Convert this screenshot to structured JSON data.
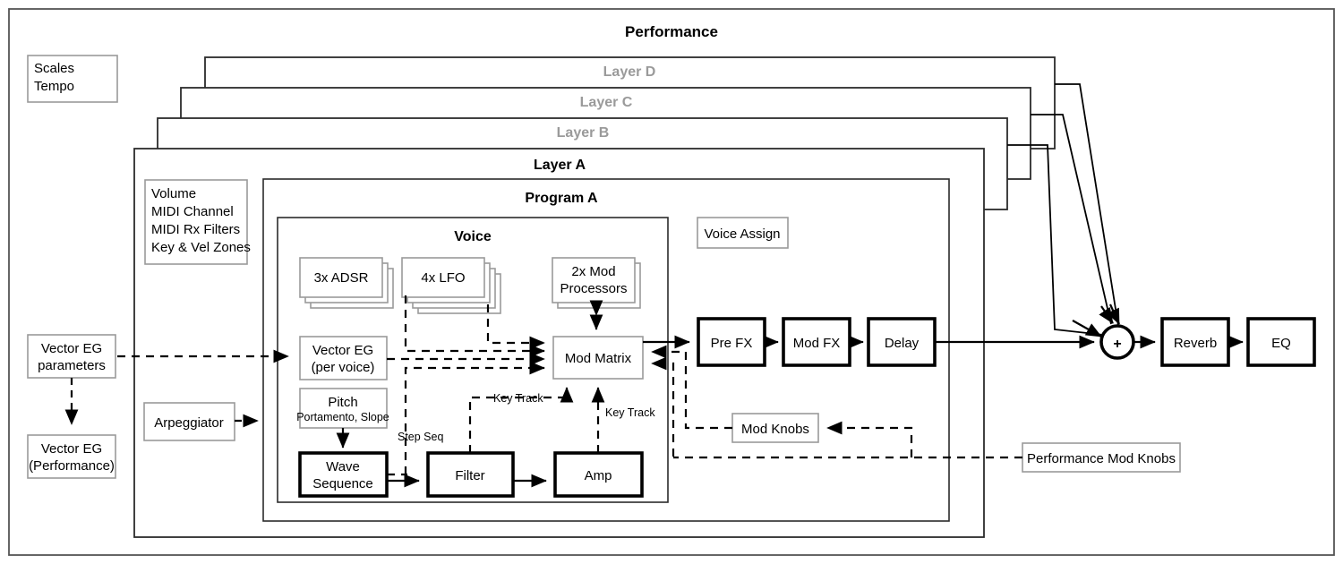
{
  "diagram": {
    "title": "Performance",
    "outer_frame": "performance-frame"
  },
  "global_boxes": {
    "scales_tempo": {
      "line1": "Scales",
      "line2": "Tempo"
    },
    "vector_eg_parameters": {
      "line1": "Vector EG",
      "line2": "parameters"
    },
    "vector_eg_performance": {
      "line1": "Vector EG",
      "line2": "(Performance)"
    },
    "arpeggiator": {
      "label": "Arpeggiator"
    },
    "performance_mod_knobs": {
      "label": "Performance Mod Knobs"
    }
  },
  "layers": [
    {
      "id": "layer-d",
      "label": "Layer D",
      "active": false
    },
    {
      "id": "layer-c",
      "label": "Layer C",
      "active": false
    },
    {
      "id": "layer-b",
      "label": "Layer B",
      "active": false
    },
    {
      "id": "layer-a",
      "label": "Layer A",
      "active": true
    }
  ],
  "layer_a": {
    "title": "Layer A",
    "params_box": {
      "line1": "Volume",
      "line2": "MIDI Channel",
      "line3": "MIDI Rx Filters",
      "line4": "Key & Vel Zones"
    },
    "program": {
      "title": "Program A",
      "voice_assign": "Voice Assign",
      "voice": {
        "title": "Voice",
        "modulators": [
          {
            "id": "adsr",
            "label": "3x ADSR",
            "count": 3
          },
          {
            "id": "lfo",
            "label": "4x LFO",
            "count": 4
          },
          {
            "id": "mod-processors",
            "line1": "2x Mod",
            "line2": "Processors",
            "count": 2
          }
        ],
        "vector_eg": {
          "line1": "Vector EG",
          "line2": "(per voice)"
        },
        "pitch": {
          "line1": "Pitch",
          "line2": "Portamento, Slope"
        },
        "mod_matrix": {
          "label": "Mod Matrix"
        },
        "signal_path": [
          {
            "id": "wave-sequence",
            "line1": "Wave",
            "line2": "Sequence"
          },
          {
            "id": "filter",
            "label": "Filter"
          },
          {
            "id": "amp",
            "label": "Amp"
          }
        ],
        "connection_labels": {
          "step_seq": "Step Seq",
          "key_track_filter": "Key Track",
          "key_track_amp": "Key Track"
        }
      }
    },
    "effects": [
      {
        "id": "pre-fx",
        "label": "Pre FX"
      },
      {
        "id": "mod-fx",
        "label": "Mod FX"
      },
      {
        "id": "delay",
        "label": "Delay"
      }
    ],
    "mod_knobs": {
      "label": "Mod Knobs"
    }
  },
  "master": {
    "mixer": {
      "symbol": "+"
    },
    "effects": [
      {
        "id": "reverb",
        "label": "Reverb"
      },
      {
        "id": "eq",
        "label": "EQ"
      }
    ]
  },
  "colors": {
    "line": "#000000",
    "thin_box_stroke": "#9a9a9a",
    "layer_stroke": "#2b2b2b",
    "ghost_text": "#9a9a9a",
    "background": "#ffffff"
  }
}
